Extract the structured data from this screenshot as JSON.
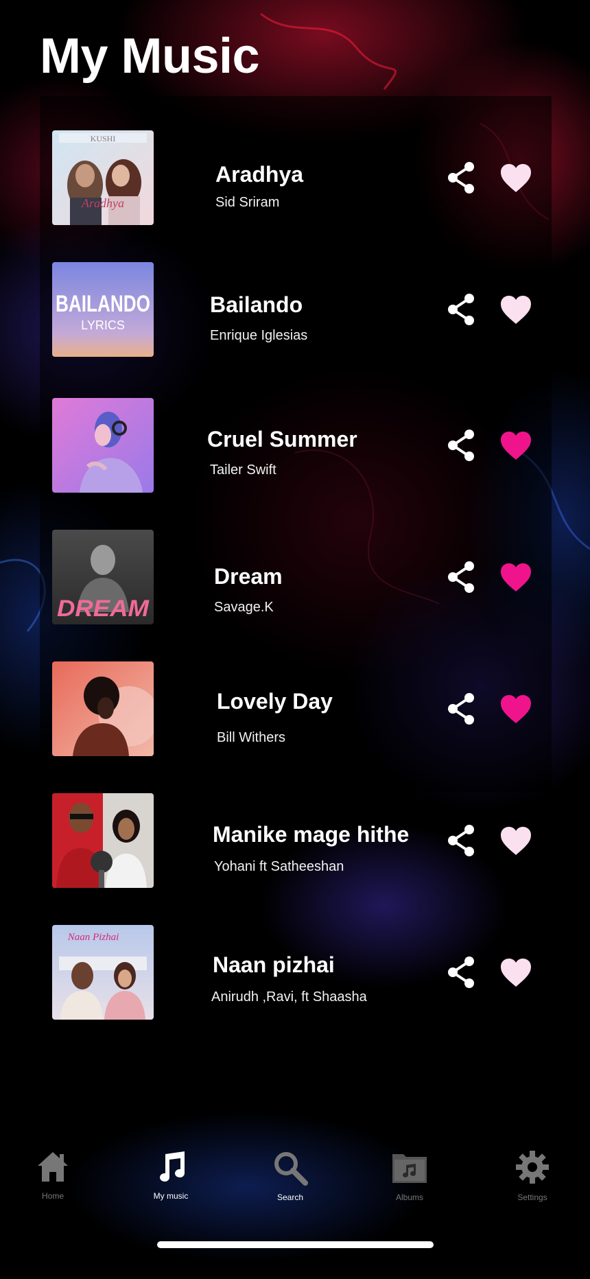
{
  "header": {
    "title": "My Music"
  },
  "songs": [
    {
      "title": "Aradhya",
      "artist": "Sid Sriram",
      "favorite": false,
      "cover_text": "Aradhya",
      "cover_top_text": "KUSHI"
    },
    {
      "title": "Bailando",
      "artist": "Enrique Iglesias",
      "favorite": false,
      "cover_text": "BAILANDO",
      "cover_sub_text": "LYRICS"
    },
    {
      "title": "Cruel Summer",
      "artist": "Tailer Swift",
      "favorite": true
    },
    {
      "title": "Dream",
      "artist": "Savage.K",
      "favorite": true,
      "cover_text": "DREAM"
    },
    {
      "title": "Lovely Day",
      "artist": "Bill Withers",
      "favorite": true
    },
    {
      "title": "Manike mage hithe",
      "artist": "Yohani ft Satheeshan",
      "favorite": false
    },
    {
      "title": "Naan pizhai",
      "artist": "Anirudh ,Ravi, ft Shaasha",
      "favorite": false,
      "cover_text": "Naan Pizhai"
    }
  ],
  "nav": {
    "items": [
      {
        "label": "Home",
        "icon": "home-icon",
        "active": false
      },
      {
        "label": "My music",
        "icon": "music-note-icon",
        "active": true
      },
      {
        "label": "Search",
        "icon": "search-icon",
        "active": false
      },
      {
        "label": "Albums",
        "icon": "album-folder-icon",
        "active": false
      },
      {
        "label": "Settings",
        "icon": "gear-icon",
        "active": false
      }
    ]
  },
  "colors": {
    "background": "#000000",
    "favorite_on": "#f0148c",
    "favorite_off": "#fbe0f0",
    "nav_inactive": "#777777",
    "nav_active": "#ffffff"
  }
}
